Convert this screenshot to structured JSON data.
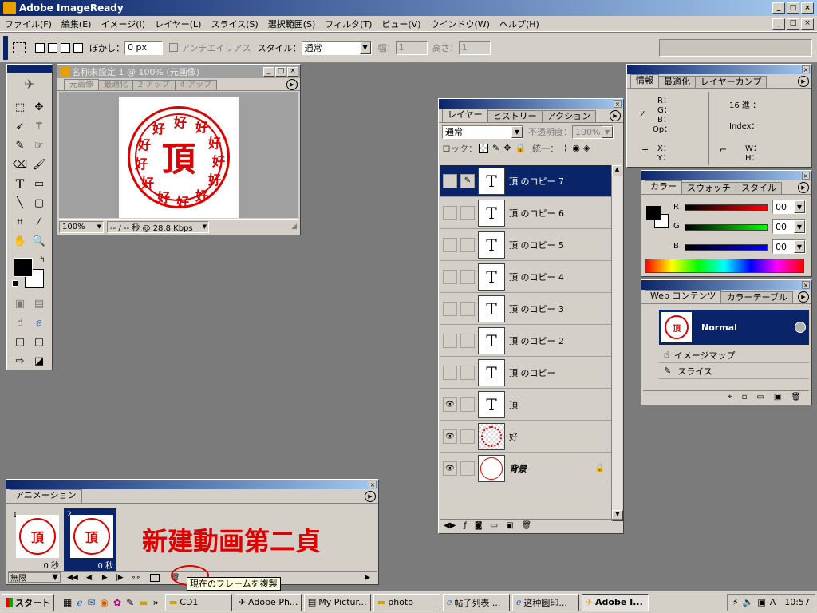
{
  "app": {
    "title": "Adobe ImageReady"
  },
  "menu": [
    "ファイル(F)",
    "編集(E)",
    "イメージ(I)",
    "レイヤー(L)",
    "スライス(S)",
    "選択範囲(S)",
    "フィルタ(T)",
    "ビュー(V)",
    "ウインドウ(W)",
    "ヘルプ(H)"
  ],
  "options": {
    "feather_label": "ぼかし：",
    "feather_value": "0 px",
    "antialias_label": "アンチエイリアス",
    "style_label": "スタイル：",
    "style_value": "通常",
    "width_label": "幅：",
    "width_value": "1",
    "height_label": "高さ：",
    "height_value": "1"
  },
  "doc": {
    "title": "名称未設定 1 @ 100% (元画像)",
    "tabs": [
      "元画像",
      "最適化",
      "2 アップ",
      "4 アップ"
    ],
    "zoom": "100%",
    "speed": "-- / -- 秒 @ 28.8 Kbps"
  },
  "stamp": {
    "center": "頂",
    "ring": "好"
  },
  "layers": {
    "tabs": [
      "レイヤー",
      "ヒストリー",
      "アクション"
    ],
    "blend": "通常",
    "opacity_label": "不透明度：",
    "opacity_value": "100%",
    "lock_label": "ロック：",
    "unify_label": "統一：",
    "items": [
      {
        "name": "頂 のコピー 7",
        "thumb": "T",
        "visible": false,
        "selected": true
      },
      {
        "name": "頂 のコピー 6",
        "thumb": "T",
        "visible": false,
        "selected": false
      },
      {
        "name": "頂 のコピー 5",
        "thumb": "T",
        "visible": false,
        "selected": false
      },
      {
        "name": "頂 のコピー 4",
        "thumb": "T",
        "visible": false,
        "selected": false
      },
      {
        "name": "頂 のコピー 3",
        "thumb": "T",
        "visible": false,
        "selected": false
      },
      {
        "name": "頂 のコピー 2",
        "thumb": "T",
        "visible": false,
        "selected": false
      },
      {
        "name": "頂 のコピー",
        "thumb": "T",
        "visible": false,
        "selected": false
      },
      {
        "name": "頂",
        "thumb": "T",
        "visible": true,
        "selected": false
      },
      {
        "name": "好",
        "thumb": "ring",
        "visible": true,
        "selected": false
      },
      {
        "name": "背景",
        "thumb": "circle",
        "visible": true,
        "selected": false,
        "italic": true,
        "locked": true
      }
    ]
  },
  "info": {
    "tabs": [
      "情報",
      "最適化",
      "レイヤーカンプ"
    ],
    "r": "R：",
    "g": "G：",
    "b": "B：",
    "op": "Op：",
    "hex": "16 進 ：",
    "index": "Index：",
    "x": "X：",
    "y": "Y：",
    "w": "W：",
    "h": "H："
  },
  "color": {
    "tabs": [
      "カラー",
      "スウォッチ",
      "スタイル"
    ],
    "r_label": "R",
    "g_label": "G",
    "b_label": "B",
    "r": "00",
    "g": "00",
    "b": "00"
  },
  "web": {
    "tabs": [
      "Web コンテンツ",
      "カラーテーブル"
    ],
    "normal": "Normal",
    "imagemap": "イメージマップ",
    "slice": "スライス"
  },
  "animation": {
    "title": "アニメーション",
    "frames": [
      {
        "num": "1",
        "delay": "0 秒"
      },
      {
        "num": "2",
        "delay": "0 秒"
      }
    ],
    "loop": "無限",
    "annotation": "新建動画第二貞",
    "tooltip": "現在のフレームを複製"
  },
  "taskbar": {
    "start": "スタート",
    "tasks": [
      {
        "label": "CD1",
        "active": false
      },
      {
        "label": "Adobe Ph...",
        "active": false
      },
      {
        "label": "My Pictur...",
        "active": false
      },
      {
        "label": "photo",
        "active": false
      },
      {
        "label": "帖子列表 ...",
        "active": false
      },
      {
        "label": "这种圆印...",
        "active": false
      },
      {
        "label": "Adobe I...",
        "active": true
      }
    ],
    "time": "10:57"
  }
}
